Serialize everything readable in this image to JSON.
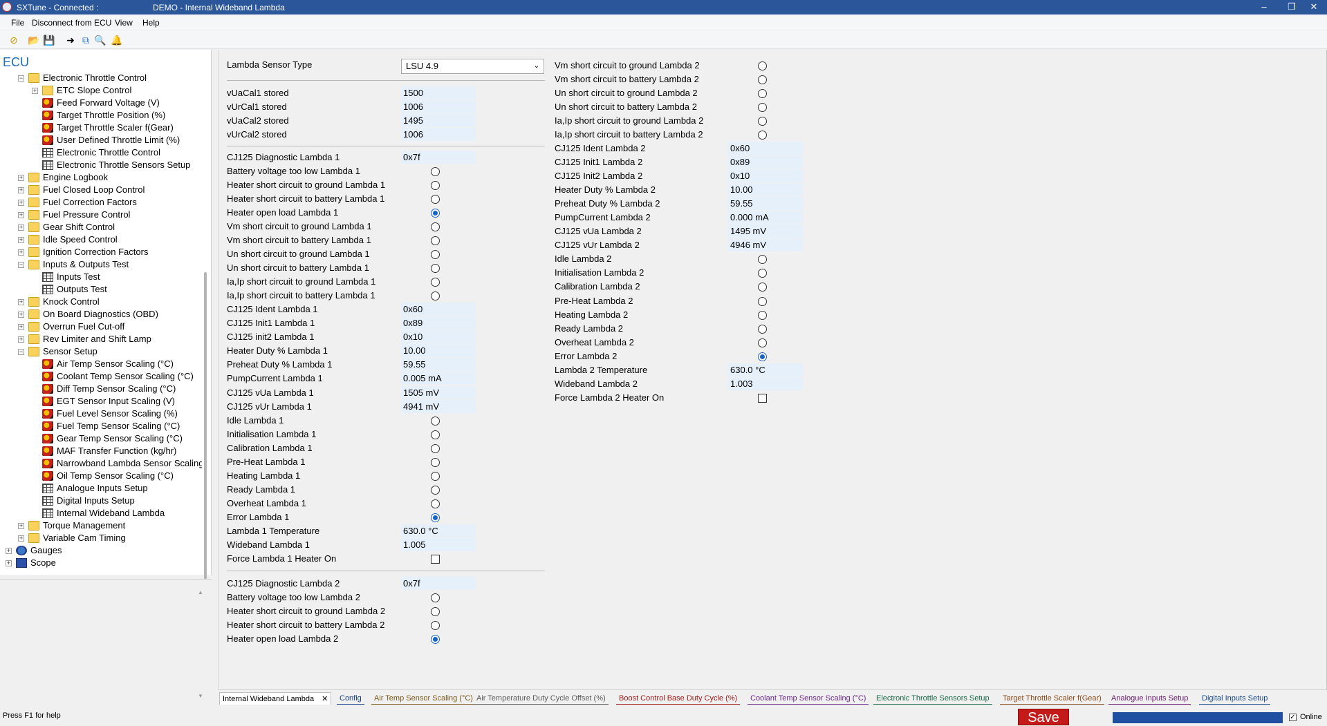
{
  "window": {
    "app_status": "SXTune - Connected :",
    "document_title": "DEMO - Internal Wideband Lambda"
  },
  "menu": [
    "File",
    "Disconnect from ECU",
    "View",
    "Help"
  ],
  "sidebar": {
    "header": "ECU",
    "items": [
      {
        "label": "Electronic Throttle Control",
        "icon": "folder-icon",
        "level": 2,
        "expander": "−"
      },
      {
        "label": "ETC Slope Control",
        "icon": "folder-icon",
        "level": 3,
        "expander": "+"
      },
      {
        "label": "Feed Forward Voltage (V)",
        "icon": "map-icon",
        "level": 3,
        "expander": ""
      },
      {
        "label": "Target Throttle Position (%)",
        "icon": "map-icon",
        "level": 3,
        "expander": ""
      },
      {
        "label": "Target Throttle Scaler f(Gear)",
        "icon": "map-icon",
        "level": 3,
        "expander": ""
      },
      {
        "label": "User Defined Throttle Limit (%)",
        "icon": "map-icon",
        "level": 3,
        "expander": ""
      },
      {
        "label": "Electronic Throttle Control",
        "icon": "grid-icon",
        "level": 3,
        "expander": ""
      },
      {
        "label": "Electronic Throttle Sensors Setup",
        "icon": "grid-icon",
        "level": 3,
        "expander": ""
      },
      {
        "label": "Engine Logbook",
        "icon": "folder-icon",
        "level": 2,
        "expander": "+"
      },
      {
        "label": "Fuel Closed Loop Control",
        "icon": "folder-icon",
        "level": 2,
        "expander": "+"
      },
      {
        "label": "Fuel Correction Factors",
        "icon": "folder-icon",
        "level": 2,
        "expander": "+"
      },
      {
        "label": "Fuel Pressure Control",
        "icon": "folder-icon",
        "level": 2,
        "expander": "+"
      },
      {
        "label": "Gear Shift Control",
        "icon": "folder-icon",
        "level": 2,
        "expander": "+"
      },
      {
        "label": "Idle Speed Control",
        "icon": "folder-icon",
        "level": 2,
        "expander": "+"
      },
      {
        "label": "Ignition Correction Factors",
        "icon": "folder-icon",
        "level": 2,
        "expander": "+"
      },
      {
        "label": "Inputs & Outputs Test",
        "icon": "folder-icon",
        "level": 2,
        "expander": "−"
      },
      {
        "label": "Inputs Test",
        "icon": "grid-icon",
        "level": 3,
        "expander": ""
      },
      {
        "label": "Outputs Test",
        "icon": "grid-icon",
        "level": 3,
        "expander": ""
      },
      {
        "label": "Knock Control",
        "icon": "folder-icon",
        "level": 2,
        "expander": "+"
      },
      {
        "label": "On Board Diagnostics (OBD)",
        "icon": "folder-icon",
        "level": 2,
        "expander": "+"
      },
      {
        "label": "Overrun Fuel Cut-off",
        "icon": "folder-icon",
        "level": 2,
        "expander": "+"
      },
      {
        "label": "Rev Limiter and Shift Lamp",
        "icon": "folder-icon",
        "level": 2,
        "expander": "+"
      },
      {
        "label": "Sensor Setup",
        "icon": "folder-icon",
        "level": 2,
        "expander": "−"
      },
      {
        "label": "Air Temp Sensor Scaling (°C)",
        "icon": "map-icon",
        "level": 3,
        "expander": ""
      },
      {
        "label": "Coolant Temp Sensor Scaling (°C)",
        "icon": "map-icon",
        "level": 3,
        "expander": ""
      },
      {
        "label": "Diff Temp Sensor Scaling (°C)",
        "icon": "map-icon",
        "level": 3,
        "expander": ""
      },
      {
        "label": "EGT Sensor Input Scaling (V)",
        "icon": "map-icon",
        "level": 3,
        "expander": ""
      },
      {
        "label": "Fuel Level Sensor Scaling (%)",
        "icon": "map-icon",
        "level": 3,
        "expander": ""
      },
      {
        "label": "Fuel Temp Sensor Scaling (°C)",
        "icon": "map-icon",
        "level": 3,
        "expander": ""
      },
      {
        "label": "Gear Temp Sensor Scaling (°C)",
        "icon": "map-icon",
        "level": 3,
        "expander": ""
      },
      {
        "label": "MAF Transfer Function (kg/hr)",
        "icon": "map-icon",
        "level": 3,
        "expander": ""
      },
      {
        "label": "Narrowband Lambda Sensor Scaling",
        "icon": "map-icon",
        "level": 3,
        "expander": ""
      },
      {
        "label": "Oil Temp Sensor Scaling (°C)",
        "icon": "map-icon",
        "level": 3,
        "expander": ""
      },
      {
        "label": "Analogue Inputs Setup",
        "icon": "grid-icon",
        "level": 3,
        "expander": ""
      },
      {
        "label": "Digital Inputs Setup",
        "icon": "grid-icon",
        "level": 3,
        "expander": ""
      },
      {
        "label": "Internal Wideband Lambda",
        "icon": "grid-icon",
        "level": 3,
        "expander": ""
      },
      {
        "label": "Torque Management",
        "icon": "folder-icon",
        "level": 2,
        "expander": "+"
      },
      {
        "label": "Variable Cam Timing",
        "icon": "folder-icon",
        "level": 2,
        "expander": "+"
      },
      {
        "label": "Gauges",
        "icon": "gauge-icon",
        "level": 1,
        "expander": "+"
      },
      {
        "label": "Scope",
        "icon": "scope-icon",
        "level": 1,
        "expander": "+"
      }
    ]
  },
  "form": {
    "sensor_type": {
      "label": "Lambda Sensor Type",
      "value": "LSU 4.9"
    },
    "cal": [
      {
        "label": "vUaCal1 stored",
        "value": "1500"
      },
      {
        "label": "vUrCal1 stored",
        "value": "1006"
      },
      {
        "label": "vUaCal2 stored",
        "value": "1495"
      },
      {
        "label": "vUrCal2 stored",
        "value": "1006"
      }
    ],
    "col1": [
      {
        "label": "CJ125 Diagnostic Lambda 1",
        "type": "value",
        "value": "0x7f"
      },
      {
        "label": "Battery voltage too low Lambda 1",
        "type": "radio",
        "checked": false
      },
      {
        "label": "Heater short circuit to ground Lambda 1",
        "type": "radio",
        "checked": false
      },
      {
        "label": "Heater short circuit to battery Lambda 1",
        "type": "radio",
        "checked": false
      },
      {
        "label": "Heater open load Lambda 1",
        "type": "radio",
        "checked": true
      },
      {
        "label": "Vm short circuit to ground Lambda 1",
        "type": "radio",
        "checked": false
      },
      {
        "label": "Vm short circuit to battery Lambda 1",
        "type": "radio",
        "checked": false
      },
      {
        "label": "Un short circuit to ground Lambda 1",
        "type": "radio",
        "checked": false
      },
      {
        "label": "Un short circuit to battery Lambda 1",
        "type": "radio",
        "checked": false
      },
      {
        "label": "Ia,Ip short circuit to ground Lambda 1",
        "type": "radio",
        "checked": false
      },
      {
        "label": "Ia,Ip short circuit to battery Lambda 1",
        "type": "radio",
        "checked": false
      },
      {
        "label": "CJ125 Ident Lambda 1",
        "type": "value",
        "value": "0x60"
      },
      {
        "label": "CJ125 Init1 Lambda 1",
        "type": "value",
        "value": "0x89"
      },
      {
        "label": "CJ125 init2 Lambda 1",
        "type": "value",
        "value": "0x10"
      },
      {
        "label": "Heater Duty % Lambda 1",
        "type": "value",
        "value": "10.00"
      },
      {
        "label": "Preheat Duty % Lambda 1",
        "type": "value",
        "value": "59.55"
      },
      {
        "label": "PumpCurrent Lambda 1",
        "type": "value",
        "value": "0.005 mA"
      },
      {
        "label": "CJ125 vUa Lambda 1",
        "type": "value",
        "value": "1505 mV"
      },
      {
        "label": "CJ125 vUr Lambda 1",
        "type": "value",
        "value": "4941 mV"
      },
      {
        "label": "Idle Lambda 1",
        "type": "radio",
        "checked": false
      },
      {
        "label": "Initialisation Lambda 1",
        "type": "radio",
        "checked": false
      },
      {
        "label": "Calibration Lambda 1",
        "type": "radio",
        "checked": false
      },
      {
        "label": "Pre-Heat Lambda 1",
        "type": "radio",
        "checked": false
      },
      {
        "label": "Heating Lambda 1",
        "type": "radio",
        "checked": false
      },
      {
        "label": "Ready Lambda 1",
        "type": "radio",
        "checked": false
      },
      {
        "label": "Overheat Lambda 1",
        "type": "radio",
        "checked": false
      },
      {
        "label": "Error Lambda 1",
        "type": "radio",
        "checked": true
      },
      {
        "label": "Lambda 1 Temperature",
        "type": "value",
        "value": "630.0 °C"
      },
      {
        "label": "Wideband Lambda 1",
        "type": "value",
        "value": "1.005"
      },
      {
        "label": "Force Lambda 1 Heater On",
        "type": "check",
        "checked": false
      }
    ],
    "col1b": [
      {
        "label": "CJ125 Diagnostic Lambda 2",
        "type": "value",
        "value": "0x7f"
      },
      {
        "label": "Battery voltage too low Lambda 2",
        "type": "radio",
        "checked": false
      },
      {
        "label": "Heater short circuit to ground Lambda 2",
        "type": "radio",
        "checked": false
      },
      {
        "label": "Heater short circuit to battery Lambda 2",
        "type": "radio",
        "checked": false
      },
      {
        "label": "Heater open load Lambda 2",
        "type": "radio",
        "checked": true
      }
    ],
    "col2": [
      {
        "label": "Vm short circuit to ground Lambda 2",
        "type": "radio",
        "checked": false
      },
      {
        "label": "Vm short circuit to battery Lambda 2",
        "type": "radio",
        "checked": false
      },
      {
        "label": "Un short circuit to ground Lambda 2",
        "type": "radio",
        "checked": false
      },
      {
        "label": "Un short circuit to battery Lambda 2",
        "type": "radio",
        "checked": false
      },
      {
        "label": "Ia,Ip short circuit to ground Lambda 2",
        "type": "radio",
        "checked": false
      },
      {
        "label": "Ia,Ip short circuit to battery Lambda 2",
        "type": "radio",
        "checked": false
      },
      {
        "label": "CJ125 Ident Lambda 2",
        "type": "value",
        "value": "0x60"
      },
      {
        "label": "CJ125 Init1 Lambda 2",
        "type": "value",
        "value": "0x89"
      },
      {
        "label": "CJ125 Init2 Lambda 2",
        "type": "value",
        "value": "0x10"
      },
      {
        "label": "Heater Duty % Lambda 2",
        "type": "value",
        "value": "10.00"
      },
      {
        "label": "Preheat Duty % Lambda 2",
        "type": "value",
        "value": "59.55"
      },
      {
        "label": "PumpCurrent Lambda 2",
        "type": "value",
        "value": "0.000 mA"
      },
      {
        "label": "CJ125 vUa Lambda 2",
        "type": "value",
        "value": "1495 mV"
      },
      {
        "label": "CJ125 vUr Lambda 2",
        "type": "value",
        "value": "4946 mV"
      },
      {
        "label": "Idle Lambda 2",
        "type": "radio",
        "checked": false
      },
      {
        "label": "Initialisation Lambda 2",
        "type": "radio",
        "checked": false
      },
      {
        "label": "Calibration Lambda 2",
        "type": "radio",
        "checked": false
      },
      {
        "label": "Pre-Heat Lambda 2",
        "type": "radio",
        "checked": false
      },
      {
        "label": "Heating Lambda 2",
        "type": "radio",
        "checked": false
      },
      {
        "label": "Ready Lambda 2",
        "type": "radio",
        "checked": false
      },
      {
        "label": "Overheat Lambda 2",
        "type": "radio",
        "checked": false
      },
      {
        "label": "Error Lambda 2",
        "type": "radio",
        "checked": true
      },
      {
        "label": "Lambda 2 Temperature",
        "type": "value",
        "value": "630.0 °C"
      },
      {
        "label": "Wideband Lambda 2",
        "type": "value",
        "value": "1.003"
      },
      {
        "label": "Force Lambda 2 Heater On",
        "type": "check",
        "checked": false
      }
    ]
  },
  "tabs": [
    {
      "label": "Internal Wideband Lambda",
      "active": true,
      "color": "#000000"
    },
    {
      "label": "Config",
      "active": false,
      "color": "#1a3e8a"
    },
    {
      "label": "Air Temp Sensor Scaling (°C)",
      "active": false,
      "color": "#7a5a1a"
    },
    {
      "label": "Air Temperature Duty Cycle Offset (%)",
      "active": false,
      "color": "#5a5a5a"
    },
    {
      "label": "Boost Control Base Duty Cycle (%)",
      "active": false,
      "color": "#a01a1a"
    },
    {
      "label": "Coolant Temp Sensor Scaling (°C)",
      "active": false,
      "color": "#6a2a8a"
    },
    {
      "label": "Electronic Throttle Sensors Setup",
      "active": false,
      "color": "#1a6a4a"
    },
    {
      "label": "Target Throttle Scaler f(Gear)",
      "active": false,
      "color": "#8a4a1a"
    },
    {
      "label": "Analogue Inputs Setup",
      "active": false,
      "color": "#6a1a6a"
    },
    {
      "label": "Digital Inputs Setup",
      "active": false,
      "color": "#1a4a8a"
    }
  ],
  "status": {
    "help": "Press F1 for help",
    "save": "Save",
    "online": "Online"
  },
  "colors": {
    "titlebar": "#2b579a",
    "value_bg": "#e6f0fa",
    "save_red": "#c41a1a",
    "progress_blue": "#1e4fa0",
    "radio_on": "#1a63c6"
  }
}
